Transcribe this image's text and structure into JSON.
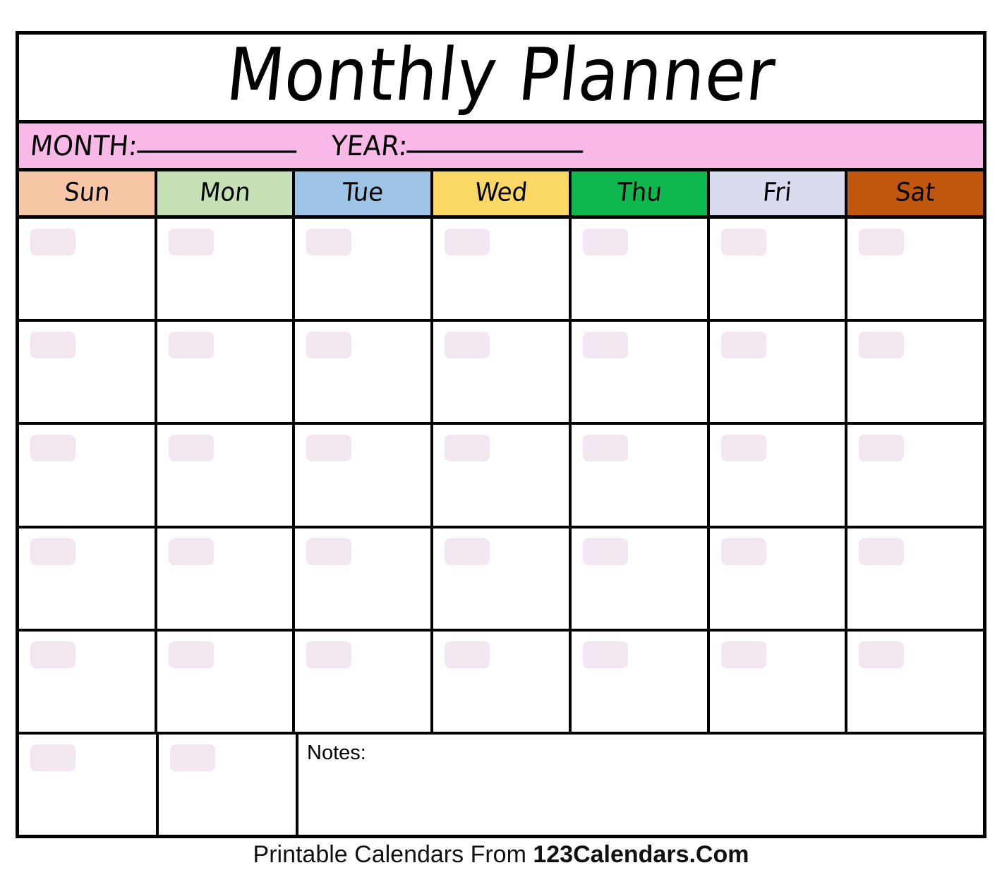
{
  "document": {
    "title": "Monthly Planner"
  },
  "fields": {
    "month_label": "MONTH:",
    "month_value": "",
    "month_blank": "___________",
    "year_label": "YEAR:",
    "year_value": "",
    "year_blank": "____________"
  },
  "weekdays": [
    {
      "label": "Sun",
      "color": "#F7C6A5"
    },
    {
      "label": "Mon",
      "color": "#C5E0B4"
    },
    {
      "label": "Tue",
      "color": "#9DC3E6"
    },
    {
      "label": "Wed",
      "color": "#FBD765"
    },
    {
      "label": "Thu",
      "color": "#0FB84F"
    },
    {
      "label": "Fri",
      "color": "#D9DCEE"
    },
    {
      "label": "Sat",
      "color": "#C1570E"
    }
  ],
  "grid": {
    "week_count": 6,
    "last_row_day_cells": 2,
    "date_numbers": [
      [
        "",
        "",
        "",
        "",
        "",
        "",
        ""
      ],
      [
        "",
        "",
        "",
        "",
        "",
        "",
        ""
      ],
      [
        "",
        "",
        "",
        "",
        "",
        "",
        ""
      ],
      [
        "",
        "",
        "",
        "",
        "",
        "",
        ""
      ],
      [
        "",
        "",
        "",
        "",
        "",
        "",
        ""
      ],
      [
        "",
        ""
      ]
    ]
  },
  "notes": {
    "label": "Notes:",
    "value": ""
  },
  "footer": {
    "prefix": "Printable Calendars From ",
    "brand": "123Calendars.Com"
  },
  "colors": {
    "band_pink": "#F8B8E8",
    "date_box": "#F2E6F0",
    "border": "#000000",
    "paper": "#FFFFFF"
  }
}
